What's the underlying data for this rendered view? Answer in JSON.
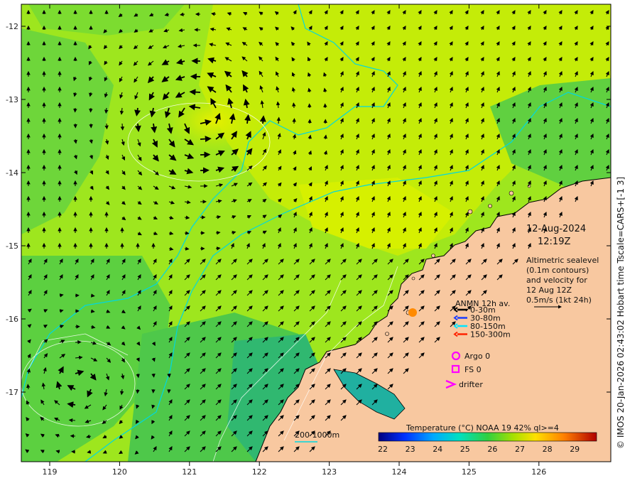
{
  "map": {
    "lon_ticks": [
      "119",
      "120",
      "121",
      "122",
      "123",
      "124",
      "125",
      "126"
    ],
    "lat_ticks": [
      "-12",
      "-13",
      "-14",
      "-15",
      "-16",
      "-17"
    ]
  },
  "stamp": {
    "date": "12-Aug-2024",
    "time": "12:19Z"
  },
  "description": {
    "line1": "Altimetric sealevel",
    "line2": "(0.1m contours)",
    "line3": "and velocity for",
    "line4": "12 Aug 12Z",
    "line5": "0.5m/s (1kt 24h)"
  },
  "legend": {
    "title": "ANMN 12h av.",
    "items": [
      {
        "label": "0-30m",
        "color": "#000000"
      },
      {
        "label": "30-80m",
        "color": "#1a3cff"
      },
      {
        "label": "80-150m",
        "color": "#00e5ff"
      },
      {
        "label": "150-300m",
        "color": "#ff2200"
      }
    ],
    "argo": "Argo 0",
    "fs": "FS 0",
    "drifter": "drifter",
    "marker_color": "#ff00ff"
  },
  "bathy": {
    "label": "200  1000m",
    "color": "#00c8d8"
  },
  "colorbar": {
    "title": "Temperature (°C) NOAA 19 42% ql>=4",
    "ticks": [
      "22",
      "23",
      "24",
      "25",
      "26",
      "27",
      "28",
      "29"
    ]
  },
  "credit": "© IMOS 20-Jan-2026 02:43:02 Hobart time Tscale=CARS+[-1 3]",
  "colors": {
    "land": "#f8c8a0",
    "sea_warm": "#c8f000",
    "sea_mid": "#6cd83a",
    "sea_cool": "#2ec060",
    "contour": "#00d8e0"
  }
}
